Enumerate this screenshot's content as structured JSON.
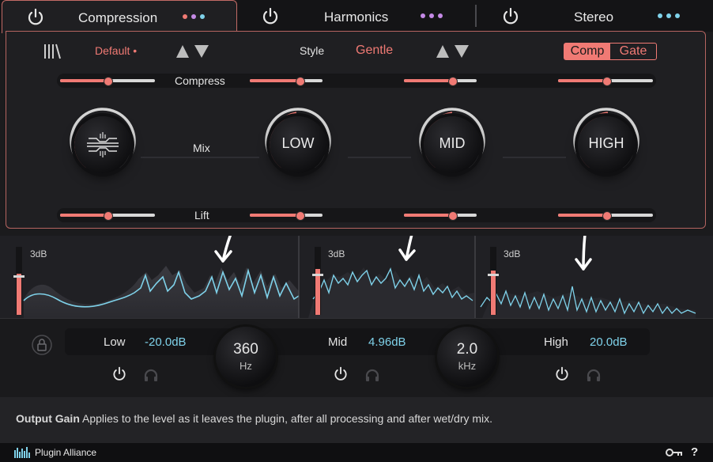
{
  "tabs": [
    {
      "label": "Compression",
      "dot_colors": [
        "#f07a74",
        "#c58ae6",
        "#7fd2ea"
      ]
    },
    {
      "label": "Harmonics",
      "dot_colors": [
        "#c58ae6",
        "#c58ae6",
        "#c58ae6"
      ]
    },
    {
      "label": "Stereo",
      "dot_colors": [
        "#7fd2ea",
        "#7fd2ea",
        "#7fd2ea"
      ]
    }
  ],
  "compression": {
    "preset": "Default",
    "preset_modified_marker": "•",
    "style_label": "Style",
    "style_value": "Gentle",
    "mode_options": [
      "Comp",
      "Gate"
    ],
    "mode_selected": "Comp",
    "compress_label": "Compress",
    "mix_label": "Mix",
    "lift_label": "Lift",
    "bands": [
      "LOW",
      "MID",
      "HIGH"
    ]
  },
  "spectrum": {
    "scale_labels": [
      "3dB",
      "3dB",
      "3dB"
    ]
  },
  "bands": {
    "low": {
      "label": "Low",
      "value": "-20.0dB"
    },
    "mid": {
      "label": "Mid",
      "value": "4.96dB"
    },
    "high": {
      "label": "High",
      "value": "20.0dB"
    },
    "crossover1": {
      "value": "360",
      "unit": "Hz"
    },
    "crossover2": {
      "value": "2.0",
      "unit": "kHz"
    }
  },
  "help": {
    "title": "Output Gain",
    "text": "Applies to the level as it leaves the plugin, after all processing and after wet/dry mix."
  },
  "footer": {
    "brand": "Plugin Alliance",
    "help_glyph": "?"
  },
  "colors": {
    "accent_red": "#f07a74",
    "accent_cyan": "#7fd2ea",
    "accent_purple": "#c58ae6"
  }
}
